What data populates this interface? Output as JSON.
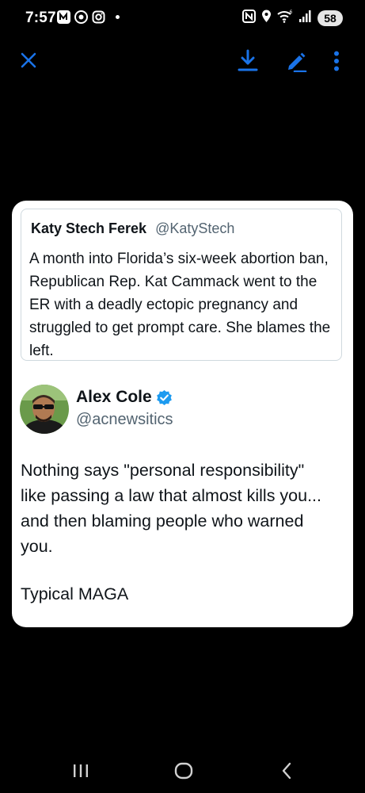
{
  "status_bar": {
    "time": "7:57",
    "left_icons": [
      "n-notification-icon",
      "chrome-icon",
      "instagram-icon",
      "more-notifications-dot"
    ],
    "right_icons": [
      "nfc-icon",
      "location-icon",
      "wifi-6-icon",
      "signal-icon"
    ],
    "battery": "58"
  },
  "toolbar": {
    "actions": [
      "close-icon",
      "download-icon",
      "edit-icon",
      "more-vert-icon"
    ],
    "accent_color": "#1a73e8"
  },
  "quoted_tweet": {
    "name": "Katy Stech Ferek",
    "handle": "@KatyStech",
    "text": "A month into Florida’s six-week abortion ban, Republican Rep. Kat Cammack went to the ER with a deadly ectopic pregnancy and struggled to get prompt care. She blames the left."
  },
  "tweet": {
    "name": "Alex Cole",
    "verified": true,
    "handle": "@acnewsitics",
    "lines": [
      "Nothing says \"personal responsibility\"",
      "like passing a law that almost kills you...",
      "and then blaming people who warned",
      "you."
    ],
    "closing": "Typical MAGA"
  },
  "nav": {
    "buttons": [
      "recents-icon",
      "home-icon",
      "back-icon"
    ]
  }
}
